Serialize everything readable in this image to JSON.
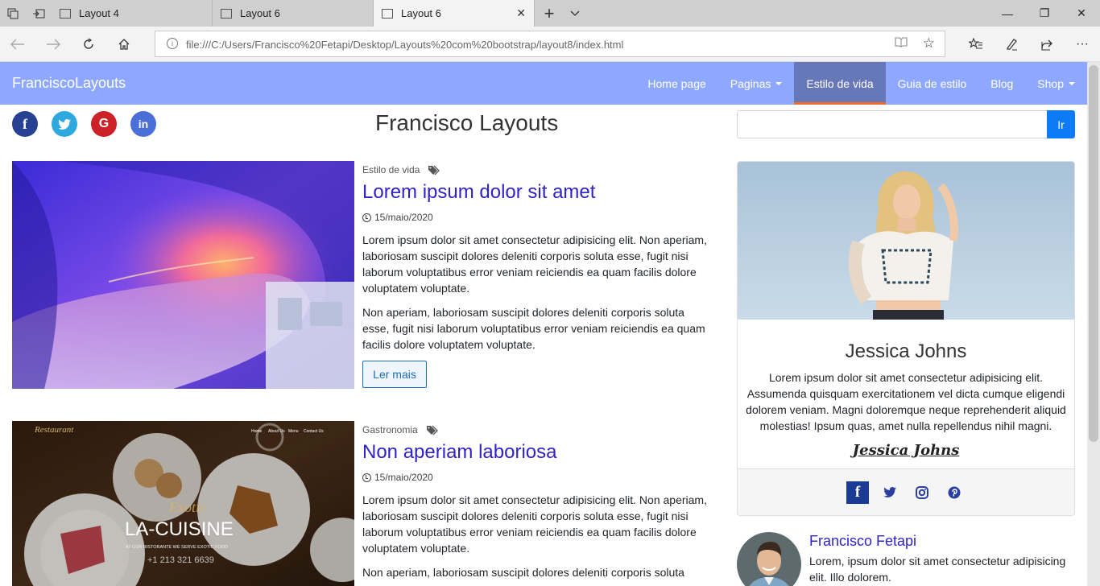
{
  "browser": {
    "tabs": [
      {
        "title": "Layout 4"
      },
      {
        "title": "Layout 6"
      },
      {
        "title": "Layout 6"
      }
    ],
    "url": "file:///C:/Users/Francisco%20Fetapi/Desktop/Layouts%20com%20bootstrap/layout8/index.html"
  },
  "navbar": {
    "brand": "FranciscoLayouts",
    "items": [
      {
        "label": "Home page"
      },
      {
        "label": "Paginas"
      },
      {
        "label": "Estilo de vida"
      },
      {
        "label": "Guia de estilo"
      },
      {
        "label": "Blog"
      },
      {
        "label": "Shop"
      }
    ]
  },
  "header": {
    "title": "Francisco Layouts",
    "search_button": "Ir",
    "search_value": ""
  },
  "posts": [
    {
      "category": "Estilo de vida",
      "title": "Lorem ipsum dolor sit amet",
      "date": "15/maio/2020",
      "paragraph1": "Lorem ipsum dolor sit amet consectetur adipisicing elit. Non aperiam, laboriosam suscipit dolores deleniti corporis soluta esse, fugit nisi laborum voluptatibus error veniam reiciendis ea quam facilis dolore voluptatem voluptate.",
      "paragraph2": "Non aperiam, laboriosam suscipit dolores deleniti corporis soluta esse, fugit nisi laborum voluptatibus error veniam reiciendis ea quam facilis dolore voluptatem voluptate.",
      "button": "Ler mais"
    },
    {
      "category": "Gastronomia",
      "title": "Non aperiam laboriosa",
      "date": "15/maio/2020",
      "paragraph1": "Lorem ipsum dolor sit amet consectetur adipisicing elit. Non aperiam, laboriosam suscipit dolores deleniti corporis soluta esse, fugit nisi laborum voluptatibus error veniam reiciendis ea quam facilis dolore voluptatem voluptate.",
      "paragraph2": "Non aperiam, laboriosam suscipit dolores deleniti corporis soluta",
      "image_text": {
        "brand": "Restaurant",
        "nav": [
          "Home",
          "About Us",
          "Menu",
          "Contact Us"
        ],
        "script": "Exotic",
        "headline": "LA-CUISINE",
        "tagline": "AT OUR RISTORANTE WE SERVE EXOTIC FOOD",
        "phone": "+1 213 321 6639"
      }
    }
  ],
  "profile": {
    "name": "Jessica Johns",
    "bio": "Lorem ipsum dolor sit amet consectetur adipisicing elit. Assumenda quisquam exercitationem vel dicta cumque eligendi dolorem veniam. Magni doloremque neque reprehenderit aliquid molestias! Ipsum quas, amet nulla repellendus nihil magni.",
    "signature": "Jessica Johns"
  },
  "author": {
    "name": "Francisco Fetapi",
    "text": "Lorem, ipsum dolor sit amet consectetur adipisicing elit. Illo dolorem."
  },
  "colors": {
    "navbar": "#8fa8ff",
    "nav_active": "#6778b8",
    "nav_active_border": "#f06a2c",
    "link": "#2f23c7",
    "search_button": "#0d7bf5"
  }
}
